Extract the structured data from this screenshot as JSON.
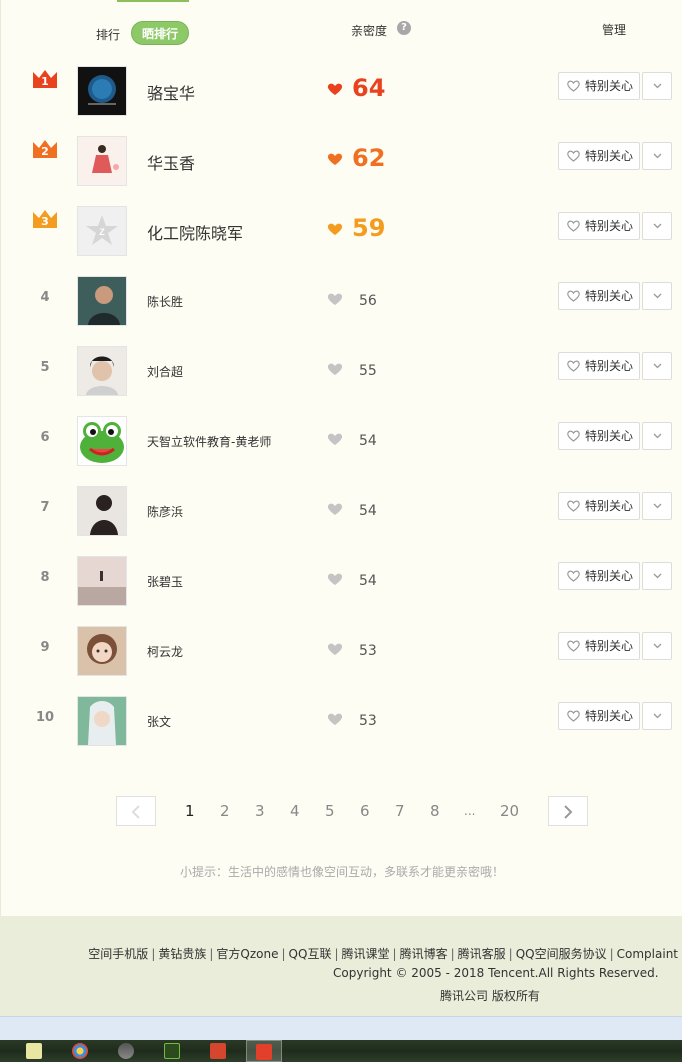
{
  "header": {
    "rank_label": "排行",
    "toggle_label": "晒排行",
    "closeness_label": "亲密度",
    "help_icon": "question-icon",
    "manage_label": "管理"
  },
  "rows": [
    {
      "rank": "1",
      "name": "骆宝华",
      "score": "64",
      "care_label": "特别关心"
    },
    {
      "rank": "2",
      "name": "华玉香",
      "score": "62",
      "care_label": "特别关心"
    },
    {
      "rank": "3",
      "name": "化工院陈晓军",
      "score": "59",
      "care_label": "特别关心"
    },
    {
      "rank": "4",
      "name": "陈长胜",
      "score": "56",
      "care_label": "特别关心"
    },
    {
      "rank": "5",
      "name": "刘合超",
      "score": "55",
      "care_label": "特别关心"
    },
    {
      "rank": "6",
      "name": "天智立软件教育-黄老师",
      "score": "54",
      "care_label": "特别关心"
    },
    {
      "rank": "7",
      "name": "陈彦浜",
      "score": "54",
      "care_label": "特别关心"
    },
    {
      "rank": "8",
      "name": "张碧玉",
      "score": "54",
      "care_label": "特别关心"
    },
    {
      "rank": "9",
      "name": "柯云龙",
      "score": "53",
      "care_label": "特别关心"
    },
    {
      "rank": "10",
      "name": "张文",
      "score": "53",
      "care_label": "特别关心"
    }
  ],
  "colors": {
    "rank1": "#e8431e",
    "rank2": "#f07022",
    "rank3": "#f39c1f",
    "accent_green": "#8ec968",
    "heart_gray": "#c4c4c4"
  },
  "pagination": {
    "pages": [
      "1",
      "2",
      "3",
      "4",
      "5",
      "6",
      "7",
      "8",
      "...",
      "20"
    ],
    "current": "1"
  },
  "tip": "小提示：生活中的感情也像空间互动，多联系才能更亲密哦！",
  "footer": {
    "links": [
      "空间手机版",
      "黄钻贵族",
      "官方Qzone",
      "QQ互联",
      "腾讯课堂",
      "腾讯博客",
      "腾讯客服",
      "QQ空间服务协议",
      "Complaint"
    ],
    "copyright": "Copyright © 2005 - 2018 Tencent.All Rights Reserved.",
    "rights": "腾讯公司 版权所有"
  }
}
